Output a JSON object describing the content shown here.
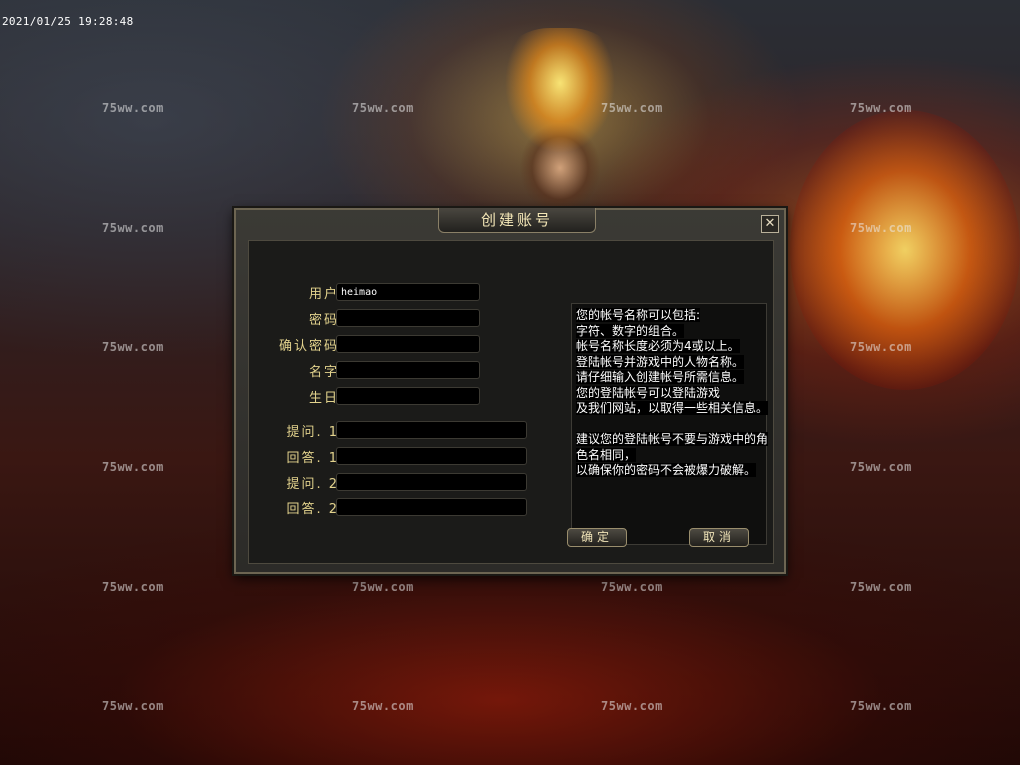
{
  "timestamp": "2021/01/25 19:28:48",
  "watermark": "75ww.com",
  "dialog": {
    "title": "创建账号",
    "close_label": "✕",
    "fields": [
      {
        "label": "用户",
        "value": "heimao"
      },
      {
        "label": "密码",
        "value": ""
      },
      {
        "label": "确认密码",
        "value": ""
      },
      {
        "label": "名字",
        "value": ""
      },
      {
        "label": "生日",
        "value": ""
      },
      {
        "label": "提问. 1",
        "value": ""
      },
      {
        "label": "回答. 1",
        "value": ""
      },
      {
        "label": "提问. 2",
        "value": ""
      },
      {
        "label": "回答. 2",
        "value": ""
      }
    ],
    "info_lines": [
      "您的帐号名称可以包括:",
      "字符、数字的组合。",
      "帐号名称长度必须为4或以上。",
      "登陆帐号并游戏中的人物名称。",
      "请仔细输入创建帐号所需信息。",
      "您的登陆帐号可以登陆游戏",
      "及我们网站，以取得一些相关信息。",
      "",
      "建议您的登陆帐号不要与游戏中的角",
      "色名相同，",
      "以确保你的密码不会被爆力破解。"
    ],
    "confirm_label": "确定",
    "cancel_label": "取消"
  }
}
